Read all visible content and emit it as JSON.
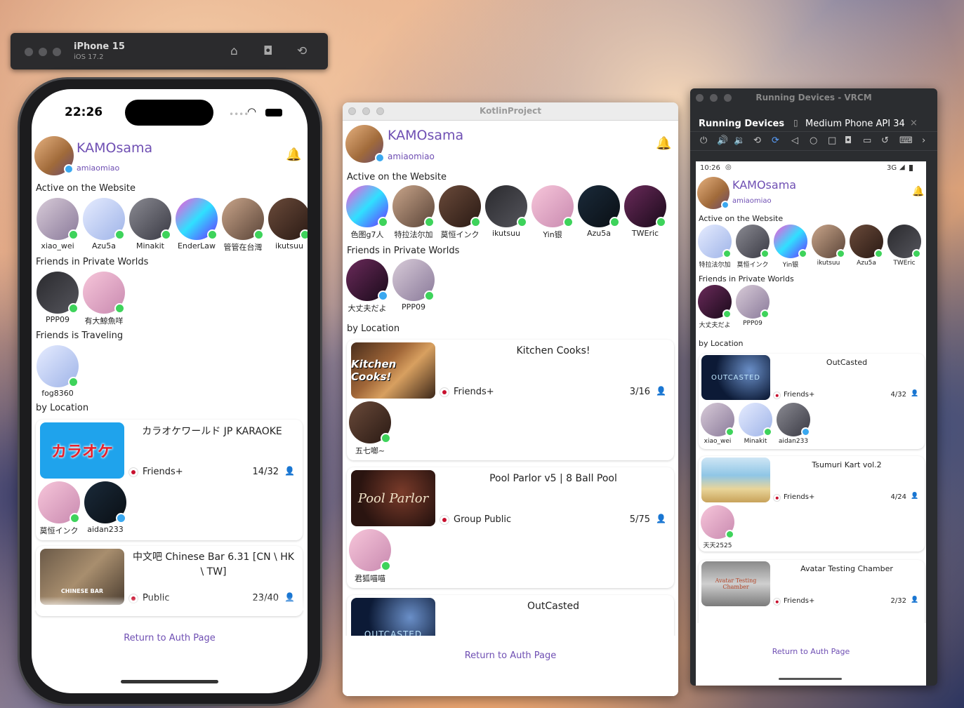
{
  "simulator": {
    "device": "iPhone 15",
    "os": "iOS 17.2",
    "icons": [
      "home-icon",
      "screenshot-icon",
      "rotate-icon"
    ]
  },
  "iphone": {
    "time": "22:26"
  },
  "mac_window": {
    "title": "KotlinProject"
  },
  "android_window": {
    "title": "Running Devices - VRCM",
    "tab_running": "Running Devices",
    "tab_device": "Medium Phone API 34",
    "status_time": "10:26",
    "status_signal": "3G"
  },
  "app": {
    "user_name": "KAMOsama",
    "user_id": "amiaomiao",
    "sec_active": "Active on the Website",
    "sec_private": "Friends in Private Worlds",
    "sec_traveling": "Friends is Traveling",
    "sec_location": "by Location",
    "return_link": "Return to Auth Page"
  },
  "iphone_view": {
    "active": [
      "xiao_wei",
      "Azu5a",
      "Minakit",
      "EnderLaw",
      "管管在台灣",
      "ikutsuu"
    ],
    "private": [
      "PPP09",
      "有大鯨魚咩"
    ],
    "traveling": [
      "fog8360"
    ],
    "locations": [
      {
        "world": "カラオケワールド JP KARAOKE",
        "thumb_text": "カラオケ",
        "instance": "Friends+",
        "count": "14/32",
        "friends": [
          "莫恒インク",
          "aidan233"
        ]
      },
      {
        "world": "中文吧 Chinese Bar 6.31 [CN \\ HK \\ TW]",
        "thumb_text": "CHINESE BAR",
        "instance": "Public",
        "count": "23/40",
        "friends": []
      }
    ]
  },
  "mac_view": {
    "active": [
      "色图g7人",
      "特拉法尔加",
      "莫恒インク",
      "ikutsuu",
      "Yin银",
      "Azu5a",
      "TWEric"
    ],
    "private": [
      "大丈夫だよ",
      "PPP09"
    ],
    "locations": [
      {
        "world": "Kitchen Cooks!",
        "thumb_text": "Kitchen Cooks!",
        "instance": "Friends+",
        "count": "3/16",
        "friends": [
          "五七啷~"
        ]
      },
      {
        "world": "Pool Parlor v5 | 8 Ball Pool",
        "thumb_text": "Pool Parlor",
        "instance": "Group Public",
        "count": "5/75",
        "friends": [
          "君狐喵喵"
        ]
      },
      {
        "world": "OutCasted",
        "thumb_text": "OUTCASTED",
        "instance": "",
        "count": "",
        "friends": []
      }
    ]
  },
  "android_view": {
    "active": [
      "特拉法尔加",
      "莫恒インク",
      "Yin银",
      "ikutsuu",
      "Azu5a",
      "TWEric"
    ],
    "private": [
      "大丈夫だよ",
      "PPP09"
    ],
    "locations": [
      {
        "world": "OutCasted",
        "thumb_text": "OUTCASTED",
        "instance": "Friends+",
        "count": "4/32",
        "friends": [
          "xiao_wei",
          "Minakit",
          "aidan233"
        ]
      },
      {
        "world": "Tsumuri Kart vol.2",
        "thumb_text": "",
        "instance": "Friends+",
        "count": "4/24",
        "friends": [
          "天天2525"
        ]
      },
      {
        "world": "Avatar Testing Chamber",
        "thumb_text": "Avatar Testing Chamber",
        "instance": "Friends+",
        "count": "2/32",
        "friends": []
      }
    ]
  },
  "colors": {
    "accent": "#6f4fb3",
    "online": "#3ed35b",
    "web": "#3aa8f0",
    "flag_red": "#c8102e"
  }
}
